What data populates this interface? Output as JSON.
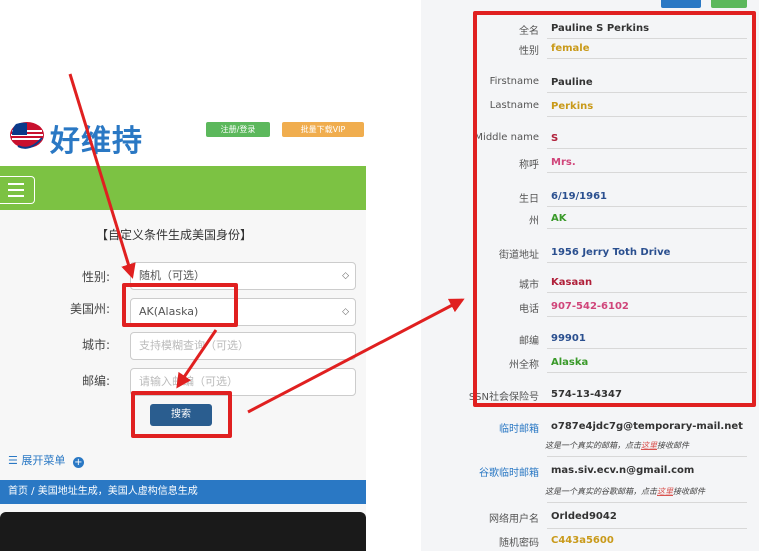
{
  "left": {
    "site_name": "好维持",
    "register_label": "注册/登录",
    "vip_label": "批量下载VIP",
    "form_title": "【自定义条件生成美国身份】",
    "gender_label": "性别:",
    "gender_value": "随机（可选）",
    "state_label": "美国州:",
    "state_value": "AK(Alaska)",
    "city_label": "城市:",
    "city_placeholder": "支持模糊查询（可选）",
    "zip_label": "邮编:",
    "zip_placeholder": "请输入邮编（可选）",
    "search_label": "搜索",
    "expand_menu": "展开菜单",
    "breadcrumb": "首页 / 美国地址生成，美国人虚构信息生成",
    "icons": [
      "us-flag-logo-icon",
      "hamburger-menu-icon",
      "select-arrow-icon",
      "plus-circle-icon"
    ]
  },
  "right": {
    "rows": [
      {
        "label": "全名",
        "value": "Pauline S Perkins",
        "color": "#333333"
      },
      {
        "label": "性别",
        "value": "female",
        "color": "#c99a1a"
      },
      {
        "label": "Firstname",
        "value": "Pauline",
        "color": "#333333"
      },
      {
        "label": "Lastname",
        "value": "Perkins",
        "color": "#c99a1a"
      },
      {
        "label": "Middle name",
        "value": "S",
        "color": "#b0203a"
      },
      {
        "label": "称呼",
        "value": "Mrs.",
        "color": "#d0457a"
      },
      {
        "label": "生日",
        "value": "6/19/1961",
        "color": "#2a4f8f"
      },
      {
        "label": "州",
        "value": "AK",
        "color": "#3a9a2a"
      },
      {
        "label": "街道地址",
        "value": "1956 Jerry Toth Drive",
        "color": "#2a4f8f"
      },
      {
        "label": "城市",
        "value": "Kasaan",
        "color": "#b0203a"
      },
      {
        "label": "电话",
        "value": "907-542-6102",
        "color": "#d0457a"
      },
      {
        "label": "邮编",
        "value": "99901",
        "color": "#2a4f8f"
      },
      {
        "label": "州全称",
        "value": "Alaska",
        "color": "#3a9a2a"
      },
      {
        "label": "SSN社会保险号",
        "value": "574-13-4347",
        "color": "#333333"
      }
    ],
    "temp_mail_label": "临时邮箱",
    "temp_mail_value": "o787e4jdc7g@temporary-mail.net",
    "temp_mail_note_pre": "这是一个真实的邮箱，点击",
    "temp_mail_note_link": "这里",
    "temp_mail_note_post": "接收邮件",
    "gmail_label": "谷歌临时邮箱",
    "gmail_value": "mas.siv.ecv.n@gmail.com",
    "gmail_note_pre": "这是一个真实的谷歌邮箱，点击",
    "gmail_note_link": "这里",
    "gmail_note_post": "接收邮件",
    "username_label": "网络用户名",
    "username_value": "Orlded9042",
    "password_label": "随机密码",
    "password_value": "C443a5600"
  },
  "colors": {
    "highlight": "#e02020",
    "brand_blue": "#2a78c4",
    "green_bar": "#7cc243"
  }
}
